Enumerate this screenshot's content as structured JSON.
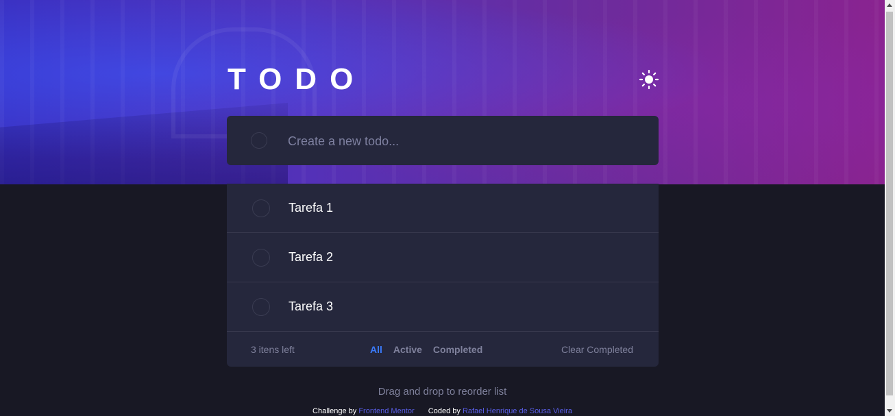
{
  "header": {
    "title": "TODO",
    "theme_icon": "sun-icon"
  },
  "new_todo": {
    "placeholder": "Create a new todo..."
  },
  "todos": [
    {
      "text": "Tarefa 1",
      "completed": false
    },
    {
      "text": "Tarefa 2",
      "completed": false
    },
    {
      "text": "Tarefa 3",
      "completed": false
    }
  ],
  "footer": {
    "items_left": "3 itens left",
    "filters": [
      "All",
      "Active",
      "Completed"
    ],
    "active_filter": "All",
    "clear_label": "Clear Completed"
  },
  "hint": "Drag and drop to reorder list",
  "attribution": {
    "challenge_prefix": "Challenge by",
    "challenge_link": "Frontend Mentor",
    "coded_prefix": "Coded by",
    "coded_link": "Rafael Henrique de Sousa Vieira"
  },
  "colors": {
    "page_bg": "#181824",
    "card_bg": "#25273c",
    "accent": "#3a7bfd",
    "muted_text": "#7f819c"
  }
}
